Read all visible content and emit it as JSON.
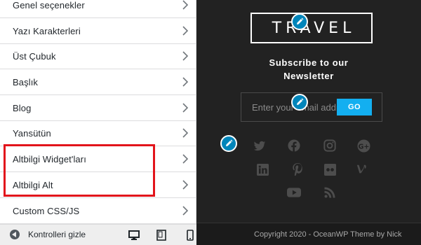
{
  "sidebar": {
    "items": [
      {
        "label": "Genel seçenekler"
      },
      {
        "label": "Yazı Karakterleri"
      },
      {
        "label": "Üst Çubuk"
      },
      {
        "label": "Başlık"
      },
      {
        "label": "Blog"
      },
      {
        "label": "Yansütün"
      },
      {
        "label": "Altbilgi Widget'ları"
      },
      {
        "label": "Altbilgi Alt"
      },
      {
        "label": "Custom CSS/JS"
      }
    ],
    "collapse_label": "Kontrolleri gizle"
  },
  "preview": {
    "logo_text": "TRAVEL",
    "subscribe_title_line1": "Subscribe to our",
    "subscribe_title_line2": "Newsletter",
    "email_placeholder": "Enter your email address",
    "go_label": "GO",
    "social_icons": [
      "twitter-icon",
      "facebook-icon",
      "instagram-icon",
      "google-plus-icon",
      "linkedin-icon",
      "pinterest-icon",
      "flickr-icon",
      "vine-icon",
      "youtube-icon",
      "rss-icon"
    ],
    "copyright": "Copyright 2020 - OceanWP Theme by Nick"
  },
  "colors": {
    "highlight": "#e2141b",
    "accent": "#13aff0",
    "edit_badge": "#0085ba",
    "preview_bg": "#222222"
  }
}
